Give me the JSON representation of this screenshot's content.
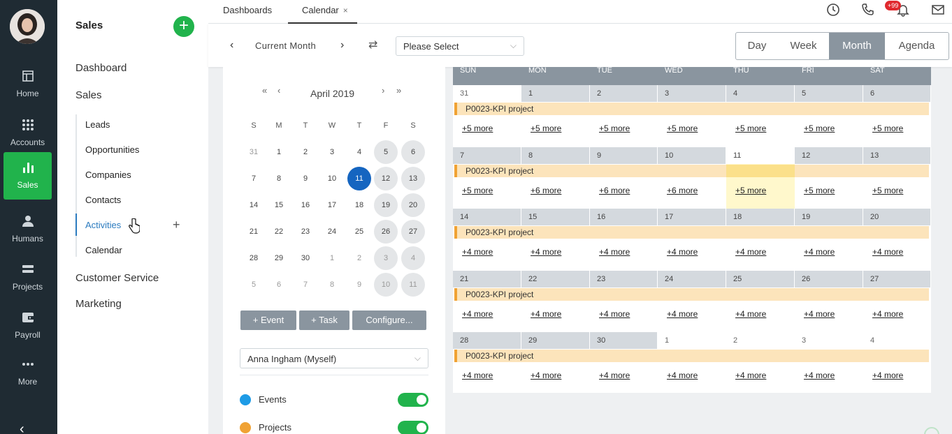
{
  "rail": {
    "items": [
      {
        "label": "Home",
        "icon": "home-icon"
      },
      {
        "label": "Accounts",
        "icon": "grid-icon"
      },
      {
        "label": "Sales",
        "icon": "bar-chart-icon"
      },
      {
        "label": "Humans",
        "icon": "person-icon"
      },
      {
        "label": "Projects",
        "icon": "projects-icon"
      },
      {
        "label": "Payroll",
        "icon": "wallet-icon"
      },
      {
        "label": "More",
        "icon": "more-icon"
      }
    ],
    "collapse": "‹"
  },
  "subnav": {
    "title": "Sales",
    "add": "+",
    "dashboard": "Dashboard",
    "sales": "Sales",
    "items": [
      "Leads",
      "Opportunities",
      "Companies",
      "Contacts",
      "Activities",
      "Calendar"
    ],
    "activities_add": "+",
    "customer_service": "Customer Service",
    "marketing": "Marketing"
  },
  "tabs": {
    "dashboards": "Dashboards",
    "calendar": "Calendar",
    "close": "×",
    "badge": "+99"
  },
  "toolbar": {
    "prev": "‹",
    "next": "›",
    "label": "Current Month",
    "refresh": "⇄",
    "select_placeholder": "Please Select",
    "chevron": "⌵",
    "views": [
      "Day",
      "Week",
      "Month",
      "Agenda"
    ]
  },
  "mini_calendar": {
    "title": "April 2019",
    "nav": {
      "prev_year": "«",
      "prev": "‹",
      "next": "›",
      "next_year": "»"
    },
    "dow": [
      "S",
      "M",
      "T",
      "W",
      "T",
      "F",
      "S"
    ],
    "weeks": [
      [
        "31",
        "1",
        "2",
        "3",
        "4",
        "5",
        "6"
      ],
      [
        "7",
        "8",
        "9",
        "10",
        "11",
        "12",
        "13"
      ],
      [
        "14",
        "15",
        "16",
        "17",
        "18",
        "19",
        "20"
      ],
      [
        "21",
        "22",
        "23",
        "24",
        "25",
        "26",
        "27"
      ],
      [
        "28",
        "29",
        "30",
        "1",
        "2",
        "3",
        "4"
      ],
      [
        "5",
        "6",
        "7",
        "8",
        "9",
        "10",
        "11"
      ]
    ],
    "today": "11",
    "buttons": [
      "+ Event",
      "+ Task",
      "Configure..."
    ],
    "owner": "Anna Ingham (Myself)",
    "filters": [
      {
        "label": "Events",
        "color": "#1e9be6"
      },
      {
        "label": "Projects",
        "color": "#f0a234"
      }
    ]
  },
  "month": {
    "dow": [
      "SUN",
      "MON",
      "TUE",
      "WED",
      "THU",
      "FRI",
      "SAT"
    ],
    "event": "P0023-KPI project",
    "weeks": [
      {
        "days": [
          "31",
          "1",
          "2",
          "3",
          "4",
          "5",
          "6"
        ],
        "more": [
          "+5 more",
          "+5 more",
          "+5 more",
          "+5 more",
          "+5 more",
          "+5 more",
          "+5 more"
        ]
      },
      {
        "days": [
          "7",
          "8",
          "9",
          "10",
          "11",
          "12",
          "13"
        ],
        "more": [
          "+5 more",
          "+6 more",
          "+6 more",
          "+6 more",
          "+5 more",
          "+5 more",
          "+5 more"
        ]
      },
      {
        "days": [
          "14",
          "15",
          "16",
          "17",
          "18",
          "19",
          "20"
        ],
        "more": [
          "+4 more",
          "+4 more",
          "+4 more",
          "+4 more",
          "+4 more",
          "+4 more",
          "+4 more"
        ]
      },
      {
        "days": [
          "21",
          "22",
          "23",
          "24",
          "25",
          "26",
          "27"
        ],
        "more": [
          "+4 more",
          "+4 more",
          "+4 more",
          "+4 more",
          "+4 more",
          "+4 more",
          "+4 more"
        ]
      },
      {
        "days": [
          "28",
          "29",
          "30",
          "1",
          "2",
          "3",
          "4"
        ],
        "more": [
          "+4 more",
          "+4 more",
          "+4 more",
          "+4 more",
          "+4 more",
          "+4 more",
          "+4 more"
        ]
      }
    ],
    "today": "11"
  },
  "colors": {
    "brand_green": "#21b34c",
    "accent_blue": "#1565c0",
    "header_gray": "#8a959f",
    "event_bg": "#fce4bb",
    "event_border": "#f0a234"
  }
}
